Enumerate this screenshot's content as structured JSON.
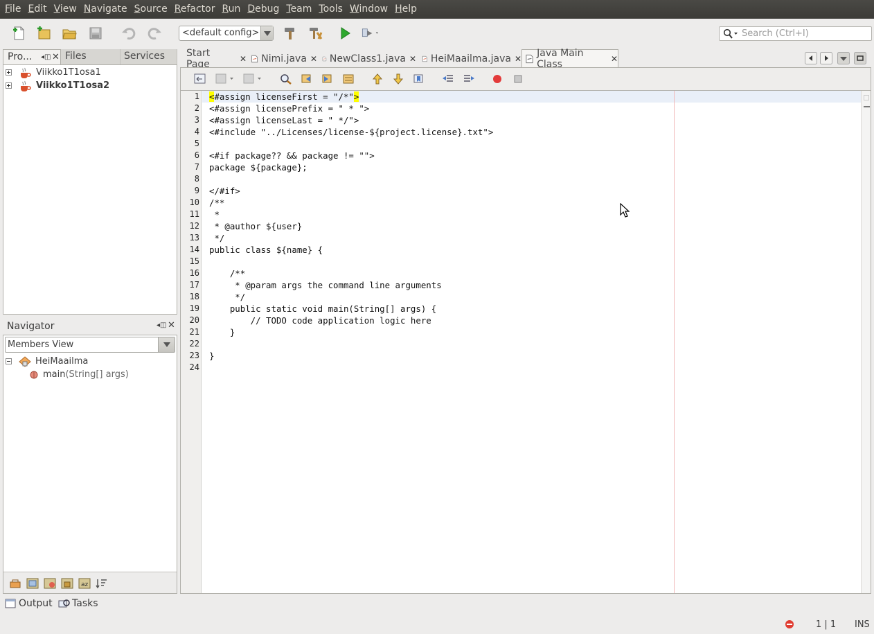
{
  "menu": [
    "File",
    "Edit",
    "View",
    "Navigate",
    "Source",
    "Refactor",
    "Run",
    "Debug",
    "Team",
    "Tools",
    "Window",
    "Help"
  ],
  "menu_mnemonics": [
    "F",
    "E",
    "V",
    "N",
    "S",
    "R",
    "R",
    "D",
    "T",
    "T",
    "W",
    "H"
  ],
  "toolbar": {
    "config": "<default config>",
    "search_placeholder": "Search (Ctrl+I)"
  },
  "projects": {
    "tabs": [
      "Pro...",
      "Files",
      "Services"
    ],
    "items": [
      "Viikko1T1osa1",
      "Viikko1T1osa2"
    ]
  },
  "navigator": {
    "title": "Navigator",
    "view": "Members View",
    "class_name": "HeiMaailma",
    "method_name": "main",
    "method_params": "(String[] args)"
  },
  "editor": {
    "tabs": [
      "Start Page",
      "Nimi.java",
      "NewClass1.java",
      "HeiMaailma.java",
      "Java Main Class"
    ],
    "active_tab": "Java Main Class",
    "line_numbers": [
      "1",
      "2",
      "3",
      "4",
      "5",
      "6",
      "7",
      "8",
      "9",
      "10",
      "11",
      "12",
      "13",
      "14",
      "15",
      "16",
      "17",
      "18",
      "19",
      "20",
      "21",
      "22",
      "23",
      "24"
    ],
    "lines": [
      "<#assign licenseFirst = \"/*\">",
      "<#assign licensePrefix = \" * \">",
      "<#assign licenseLast = \" */\">",
      "<#include \"../Licenses/license-${project.license}.txt\">",
      "",
      "<#if package?? && package != \"\">",
      "package ${package};",
      "",
      "</#if>",
      "/**",
      " *",
      " * @author ${user}",
      " */",
      "public class ${name} {",
      "",
      "    /**",
      "     * @param args the command line arguments",
      "     */",
      "    public static void main(String[] args) {",
      "        // TODO code application logic here",
      "    }",
      "",
      "}",
      ""
    ]
  },
  "bottom": {
    "output": "Output",
    "tasks": "Tasks"
  },
  "status": {
    "position": "1 | 1",
    "mode": "INS"
  },
  "colors": {
    "menubar": "#3c3b37",
    "window": "#edeceb",
    "current_line": "#e9eff8",
    "bracket_highlight": "#ffff00",
    "margin_line": "#f0b8b8",
    "run_green": "#2ea82e",
    "error_red": "#e03c31"
  }
}
